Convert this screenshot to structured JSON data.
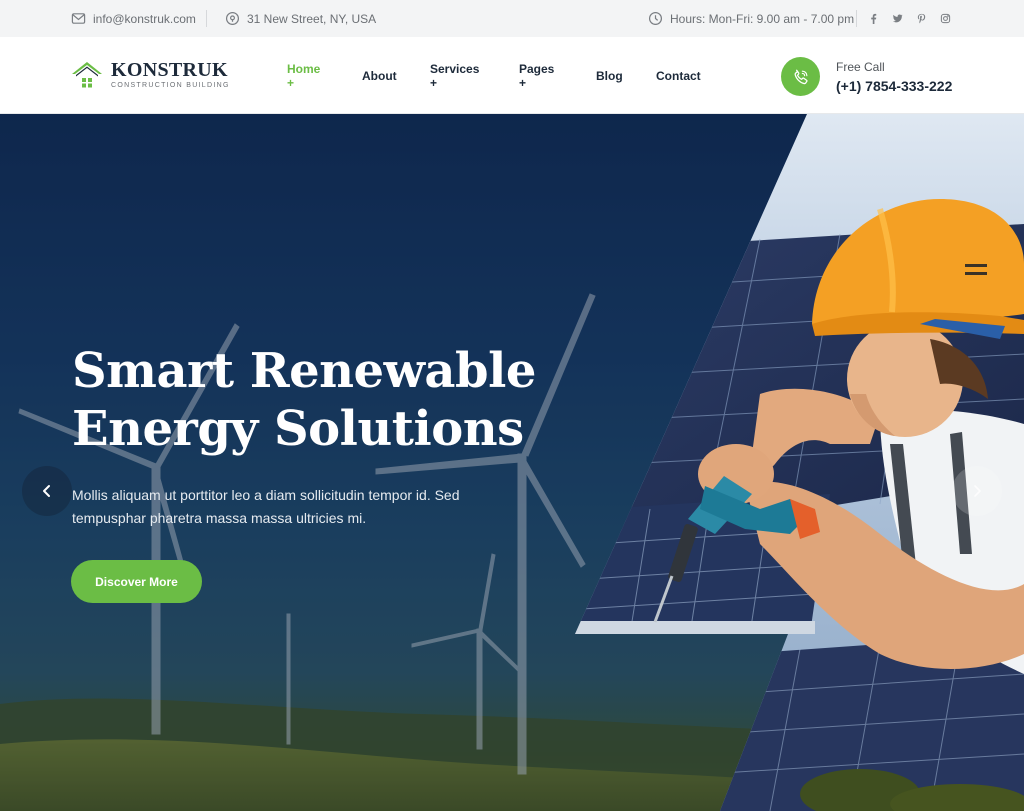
{
  "topbar": {
    "email": "info@konstruk.com",
    "address": "31 New Street, NY, USA",
    "hours": "Hours: Mon-Fri: 9.00 am - 7.00 pm",
    "social_icons": [
      "facebook-icon",
      "twitter-icon",
      "pinterest-icon",
      "instagram-icon"
    ]
  },
  "logo": {
    "name": "KONSTRUK",
    "tagline": "CONSTRUCTION BUILDING"
  },
  "nav": {
    "items": [
      {
        "label": "Home +",
        "active": true
      },
      {
        "label": "About",
        "active": false
      },
      {
        "label": "Services +",
        "active": false
      },
      {
        "label": "Pages +",
        "active": false
      },
      {
        "label": "Blog",
        "active": false
      },
      {
        "label": "Contact",
        "active": false
      }
    ]
  },
  "call": {
    "label": "Free Call",
    "number": "(+1) 7854-333-222"
  },
  "hero": {
    "title_line1": "Smart Renewable",
    "title_line2": "Energy Solutions",
    "subtitle_line1": "Mollis aliquam ut porttitor leo a diam sollicitudin tempor id. Sed",
    "subtitle_line2": "tempusphar pharetra massa massa ultricies mi.",
    "button_label": "Discover More"
  },
  "colors": {
    "accent": "#6bbd45",
    "dark": "#1d2a3a",
    "topbar_bg": "#f3f4f5"
  }
}
